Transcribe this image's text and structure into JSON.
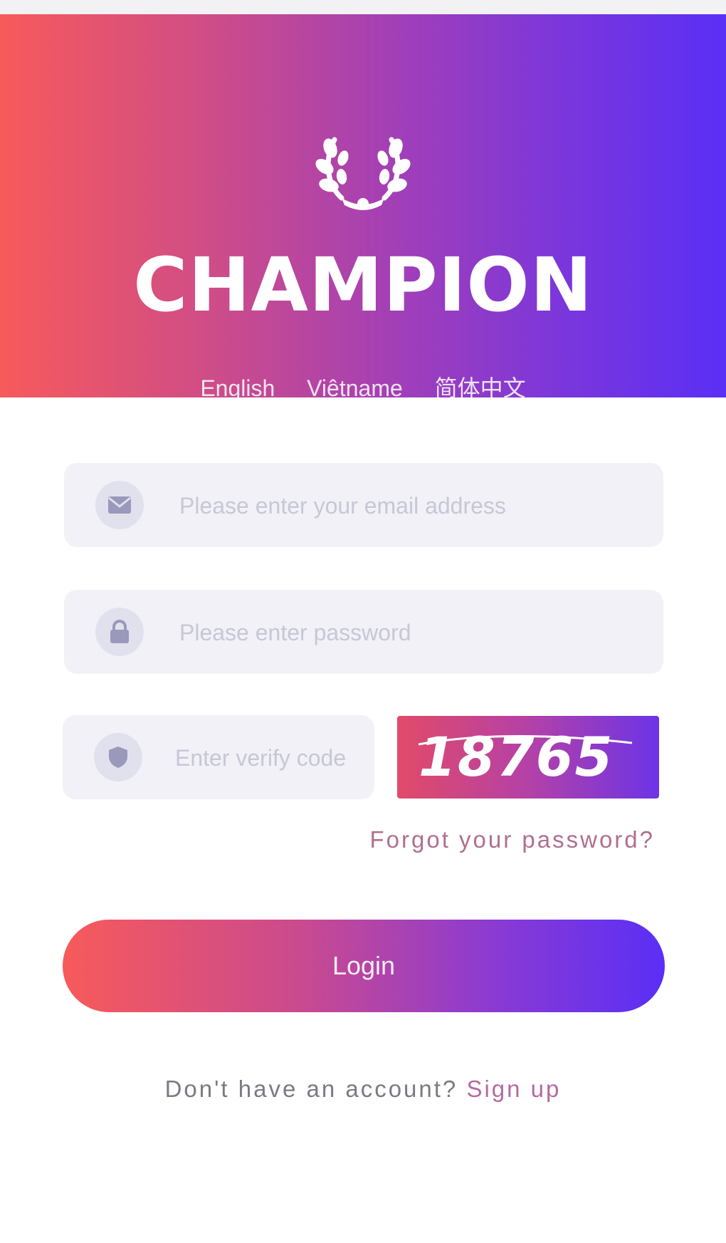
{
  "brand": {
    "name": "CHAMPION",
    "logo_icon": "laurel-wreath-icon"
  },
  "languages": [
    {
      "label": "English"
    },
    {
      "label": "Việtname"
    },
    {
      "label": "简体中文"
    }
  ],
  "form": {
    "email": {
      "placeholder": "Please enter your email address",
      "value": "",
      "icon": "mail-icon"
    },
    "password": {
      "placeholder": "Please enter password",
      "value": "",
      "icon": "lock-icon"
    },
    "verify": {
      "placeholder": "Enter verify code",
      "value": "",
      "icon": "shield-icon"
    },
    "captcha_code": "18765",
    "forgot_label": "Forgot your password?",
    "login_label": "Login"
  },
  "signup": {
    "prompt": "Don't have an account?",
    "link_label": "Sign up"
  },
  "colors": {
    "gradient_start": "#f75a5a",
    "gradient_end": "#5a2ff6",
    "field_bg": "#f1f1f7"
  }
}
